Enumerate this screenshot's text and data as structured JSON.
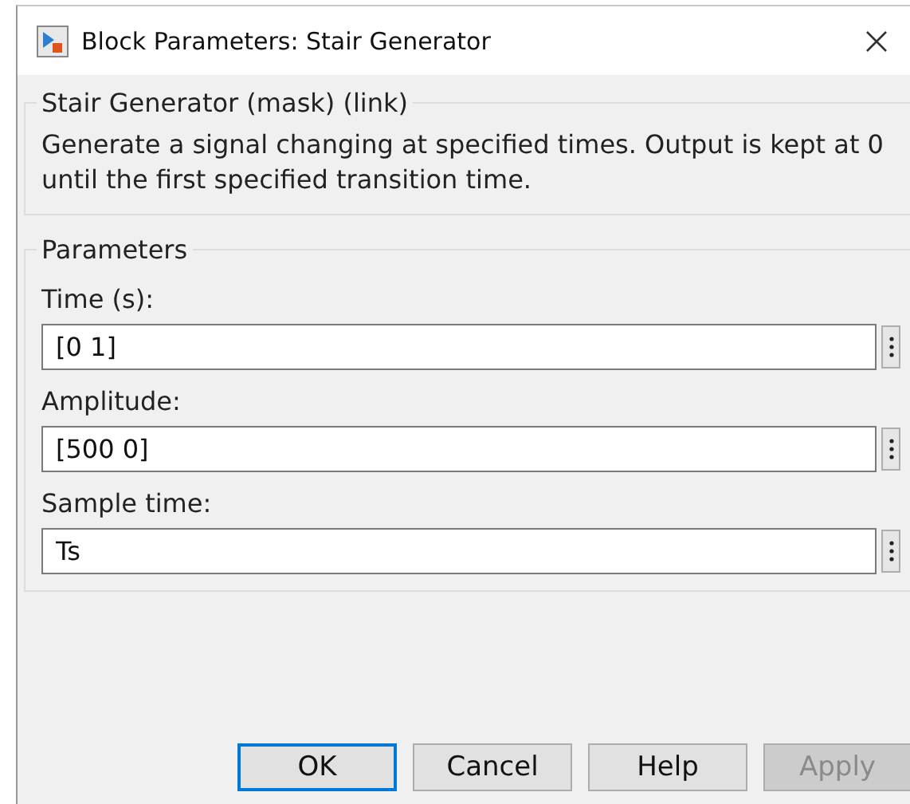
{
  "window": {
    "title": "Block Parameters: Stair Generator"
  },
  "description_group": {
    "legend": "Stair Generator (mask) (link)",
    "text": "Generate a signal changing at specified times. Output is kept at 0 until the first specified transition time."
  },
  "parameters_group": {
    "legend": "Parameters",
    "fields": [
      {
        "label": "Time (s):",
        "value": "[0 1]"
      },
      {
        "label": "Amplitude:",
        "value": "[500 0]"
      },
      {
        "label": "Sample time:",
        "value": "Ts"
      }
    ]
  },
  "buttons": [
    {
      "label": "OK",
      "default": true,
      "disabled": false
    },
    {
      "label": "Cancel",
      "default": false,
      "disabled": false
    },
    {
      "label": "Help",
      "default": false,
      "disabled": false
    },
    {
      "label": "Apply",
      "default": false,
      "disabled": true
    }
  ]
}
